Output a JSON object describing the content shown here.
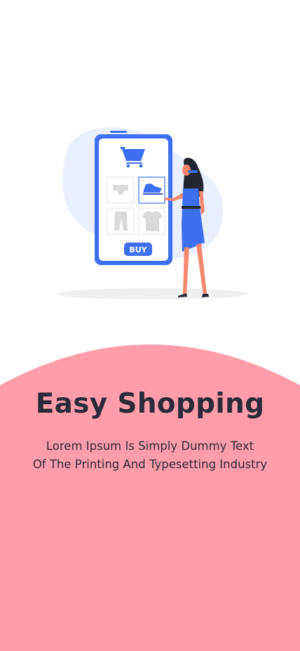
{
  "onboarding": {
    "title": "Easy Shopping",
    "description_line1": "Lorem Ipsum Is Simply Dummy Text",
    "description_line2": "Of The Printing And Typesetting Industry",
    "illustration": {
      "button_label": "BUY",
      "icon": "shopping-cart-icon"
    }
  },
  "colors": {
    "panel": "#ff9eaa",
    "accent": "#3d6ff0",
    "text": "#2a2b38"
  }
}
